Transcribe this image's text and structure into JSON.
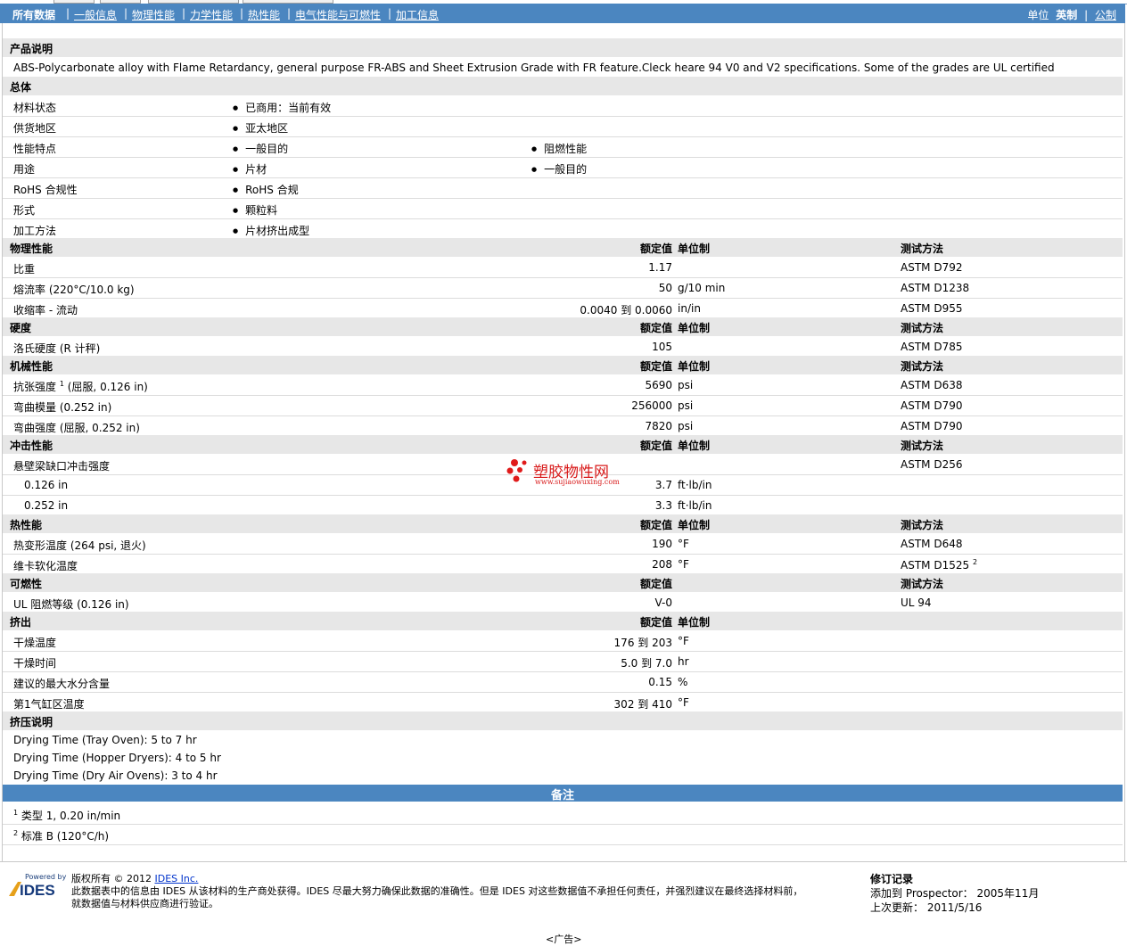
{
  "nav": {
    "tabs": [
      "所有数据",
      "一般信息",
      "物理性能",
      "力学性能",
      "热性能",
      "电气性能与可燃性",
      "加工信息"
    ],
    "unit_label": "单位",
    "unit_english": "英制",
    "unit_metric": "公制"
  },
  "desc": {
    "title": "产品说明",
    "text": "ABS-Polycarbonate alloy with Flame Retardancy, general purpose FR-ABS and Sheet Extrusion Grade with FR feature.Cleck heare 94 V0 and V2 specifications. Some of the grades are UL certified"
  },
  "headers": {
    "value": "额定值",
    "unit": "单位制",
    "method": "测试方法"
  },
  "general": {
    "title": "总体",
    "rows": [
      {
        "label": "材料状态",
        "b1": "已商用：当前有效",
        "b2": ""
      },
      {
        "label": "供货地区",
        "b1": "亚太地区",
        "b2": ""
      },
      {
        "label": "性能特点",
        "b1": "一般目的",
        "b2": "阻燃性能"
      },
      {
        "label": "用途",
        "b1": "片材",
        "b2": "一般目的"
      },
      {
        "label": "RoHS 合规性",
        "b1": "RoHS 合规",
        "b2": ""
      },
      {
        "label": "形式",
        "b1": "颗粒料",
        "b2": ""
      },
      {
        "label": "加工方法",
        "b1": "片材挤出成型",
        "b2": ""
      }
    ]
  },
  "physical": {
    "title": "物理性能",
    "rows": [
      {
        "label": "比重",
        "value": "1.17",
        "unit": "",
        "method": "ASTM D792"
      },
      {
        "label": "熔流率  (220°C/10.0 kg)",
        "value": "50",
        "unit": "g/10 min",
        "method": "ASTM D1238"
      },
      {
        "label": "收缩率  - 流动",
        "value": "0.0040 到  0.0060",
        "unit": "in/in",
        "method": "ASTM D955"
      }
    ]
  },
  "hardness": {
    "title": "硬度",
    "rows": [
      {
        "label": "洛氏硬度  (R 计秤)",
        "value": "105",
        "unit": "",
        "method": "ASTM D785"
      }
    ]
  },
  "mechanical": {
    "title": "机械性能",
    "rows": [
      {
        "label": "抗张强度",
        "sup": "1",
        "label_tail": " (屈服, 0.126 in)",
        "value": "5690",
        "unit": "psi",
        "method": "ASTM D638"
      },
      {
        "label": "弯曲模量  (0.252 in)",
        "value": "256000",
        "unit": "psi",
        "method": "ASTM D790"
      },
      {
        "label": "弯曲强度  (屈服, 0.252 in)",
        "value": "7820",
        "unit": "psi",
        "method": "ASTM D790"
      }
    ]
  },
  "impact": {
    "title": "冲击性能",
    "rows": [
      {
        "label": "悬壁梁缺口冲击强度",
        "value": "",
        "unit": "",
        "method": "ASTM D256"
      },
      {
        "label": "0.126 in",
        "value": "3.7",
        "unit": "ft·lb/in",
        "method": ""
      },
      {
        "label": "0.252 in",
        "value": "3.3",
        "unit": "ft·lb/in",
        "method": ""
      }
    ]
  },
  "thermal": {
    "title": "热性能",
    "rows": [
      {
        "label": "热变形温度  (264 psi, 退火)",
        "value": "190",
        "unit": "°F",
        "method": "ASTM D648"
      },
      {
        "label": "维卡软化温度",
        "value": "208",
        "unit": "°F",
        "method": "ASTM D1525",
        "method_sup": "2"
      }
    ]
  },
  "flammability": {
    "title": "可燃性",
    "rows": [
      {
        "label": "UL 阻燃等级  (0.126 in)",
        "value": "V-0",
        "unit": "",
        "method": "UL 94"
      }
    ]
  },
  "extrusion": {
    "title": "挤出",
    "rows": [
      {
        "label": "干燥温度",
        "value": "176 到  203",
        "unit": "°F"
      },
      {
        "label": "干燥时间",
        "value": "5.0 到  7.0",
        "unit": "hr"
      },
      {
        "label": "建议的最大水分含量",
        "value": "0.15",
        "unit": "%"
      },
      {
        "label": "第1气缸区温度",
        "value": "302 到  410",
        "unit": "°F"
      }
    ]
  },
  "extrusion_notes": {
    "title": "挤压说明",
    "lines": [
      "Drying Time (Tray Oven): 5 to 7 hr",
      "Drying Time (Hopper Dryers): 4 to 5 hr",
      "Drying Time (Dry Air Ovens): 3 to 4 hr"
    ]
  },
  "footnotes": {
    "title": "备注",
    "items": [
      {
        "num": "1",
        "text": "类型  1, 0.20 in/min"
      },
      {
        "num": "2",
        "text": "标准  B (120°C/h)"
      }
    ]
  },
  "watermark": {
    "name": "塑胶物性网",
    "url": "www.sujiaowuxing.com"
  },
  "footer": {
    "powered_by": "Powered by",
    "logo_text": "IDES",
    "copyright_prefix": "版权所有  © 2012",
    "company_link": "IDES Inc.",
    "disclaimer_1": "此数据表中的信息由  IDES 从该材料的生产商处获得。IDES 尽最大努力确保此数据的准确性。但是  IDES 对这些数据值不承担任何责任，并强烈建议在最终选择材料前，",
    "disclaimer_2": "就数据值与材料供应商进行验证。",
    "rev_title": "修订记录",
    "added_label": "添加到  Prospector：",
    "added_value": "2005年11月",
    "updated_label": "上次更新：",
    "updated_value": "2011/5/16",
    "ad": "<广告>"
  }
}
